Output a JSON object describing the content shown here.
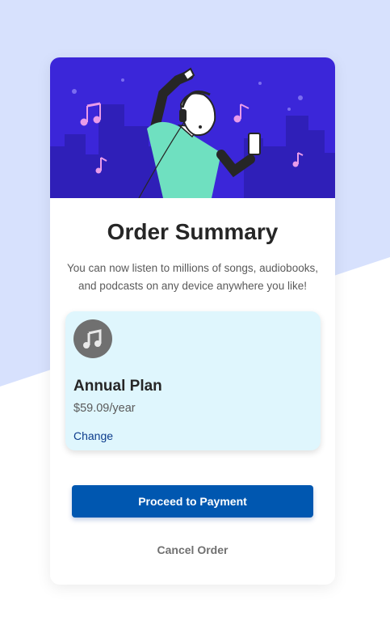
{
  "background": {
    "color_top": "#d7e1fd",
    "color_bottom": "#ffffff"
  },
  "card": {
    "hero": {
      "background": "#3b26d9",
      "illustration": "person-dancing-with-headphones"
    },
    "title": "Order Summary",
    "description": "You can now listen to millions of songs, audiobooks, and podcasts on any device anywhere you like!",
    "plan": {
      "icon": "music-note-icon",
      "name": "Annual Plan",
      "price": "$59.09/year",
      "change_label": "Change",
      "box_color": "#dff6fd"
    },
    "proceed_label": "Proceed to Payment",
    "cancel_label": "Cancel Order",
    "accent_color": "#0057b0"
  }
}
